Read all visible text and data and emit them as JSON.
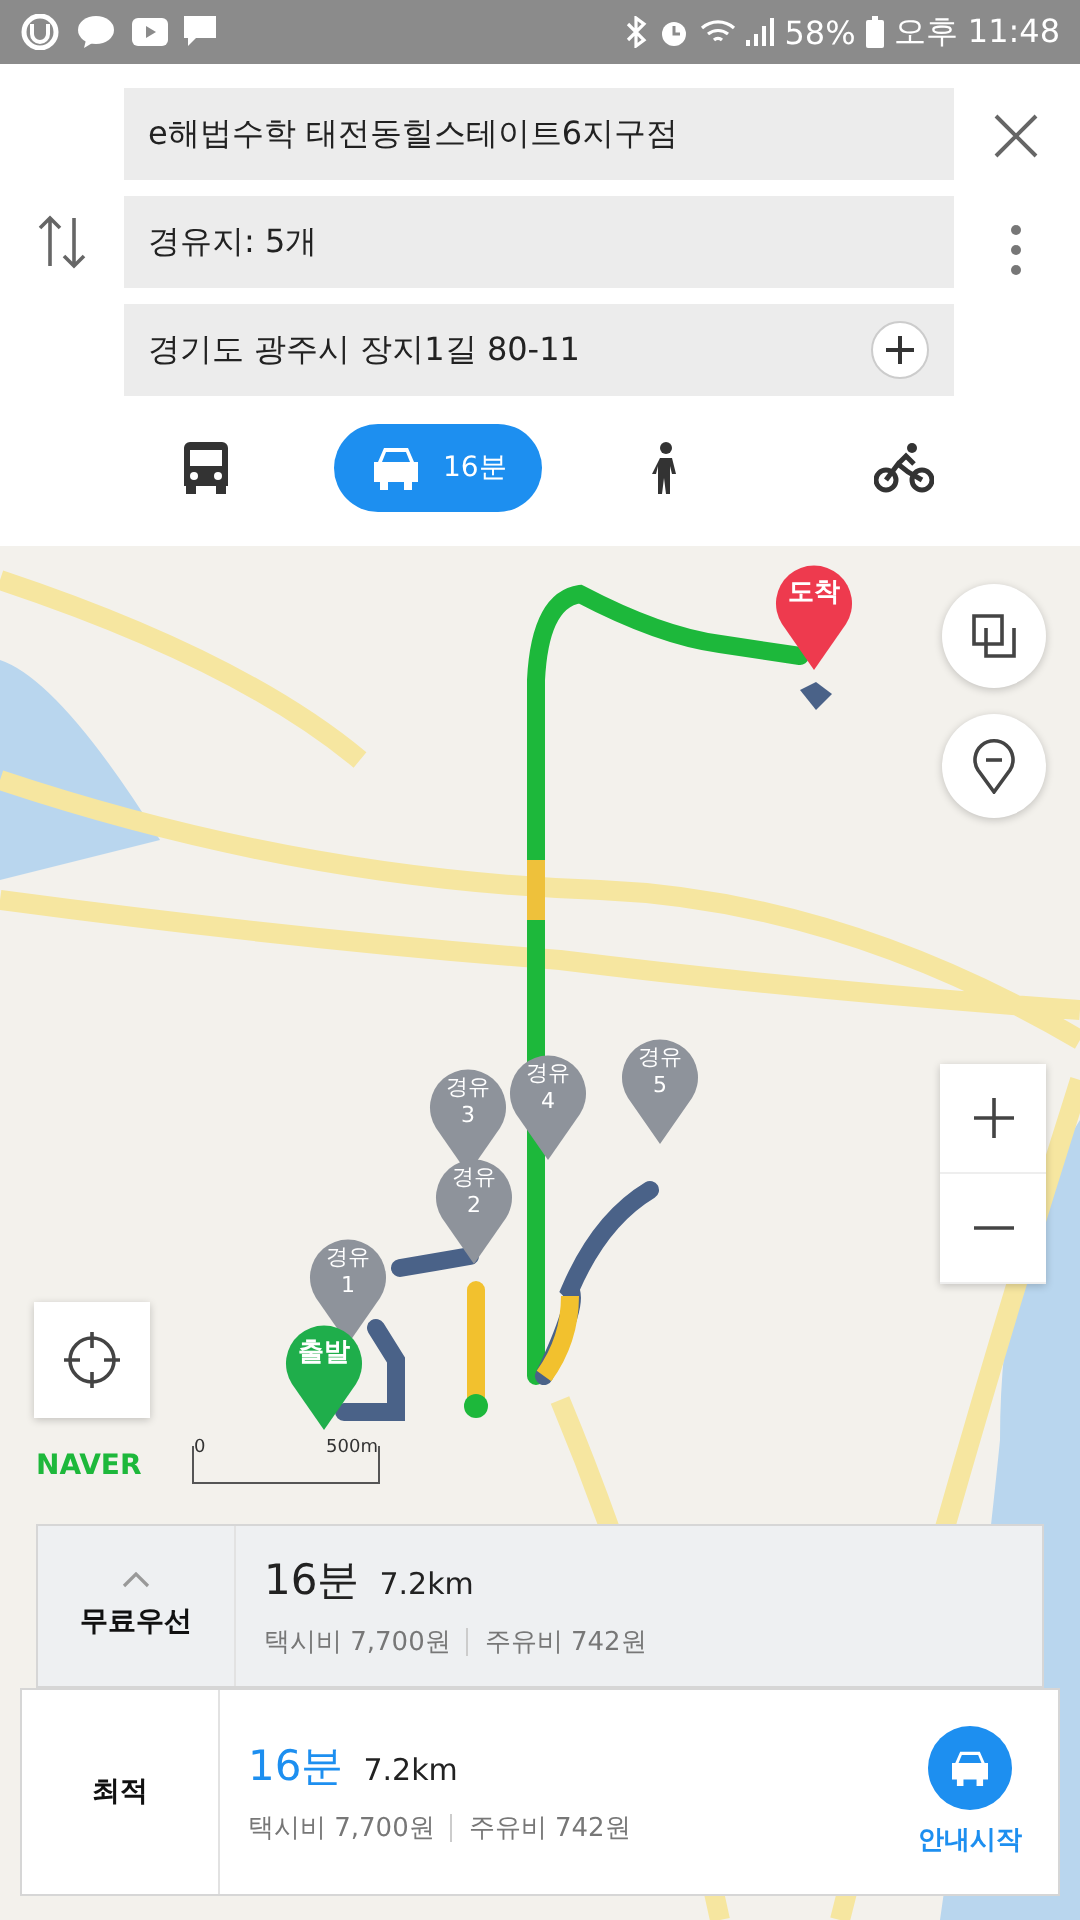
{
  "status_bar": {
    "battery": "58%",
    "time": "오후 11:48"
  },
  "route_fields": [
    {
      "kind": "text",
      "value": "e해법수학 태전동힐스테이트6지구점"
    },
    {
      "kind": "text",
      "value": "경유지: 5개"
    },
    {
      "kind": "add",
      "value": "경기도 광주시 장지1길 80-11"
    }
  ],
  "modes": [
    {
      "kind": "bus",
      "selected": false
    },
    {
      "kind": "car",
      "selected": true,
      "label": "16분"
    },
    {
      "kind": "walk",
      "selected": false
    },
    {
      "kind": "bike",
      "selected": false
    }
  ],
  "markers": [
    {
      "kind": "end",
      "label": "도착"
    },
    {
      "kind": "waypoint",
      "label": "경유",
      "number": "3"
    },
    {
      "kind": "waypoint",
      "label": "경유",
      "number": "4"
    },
    {
      "kind": "waypoint",
      "label": "경유",
      "number": "5"
    },
    {
      "kind": "waypoint",
      "label": "경유",
      "number": "2"
    },
    {
      "kind": "waypoint",
      "label": "경유",
      "number": "1"
    },
    {
      "kind": "start",
      "label": "출발"
    }
  ],
  "map_logo": "NAVER",
  "scale": {
    "start": "0",
    "end": "500m"
  },
  "routes": [
    {
      "name": "무료우선",
      "time": "16분",
      "distance": "7.2km",
      "taxi": "택시비 7,700원",
      "fuel": "주유비 742원",
      "selected": false
    },
    {
      "name": "최적",
      "time": "16분",
      "distance": "7.2km",
      "taxi": "택시비 7,700원",
      "fuel": "주유비 742원",
      "selected": true
    }
  ],
  "start_button": "안내시작"
}
